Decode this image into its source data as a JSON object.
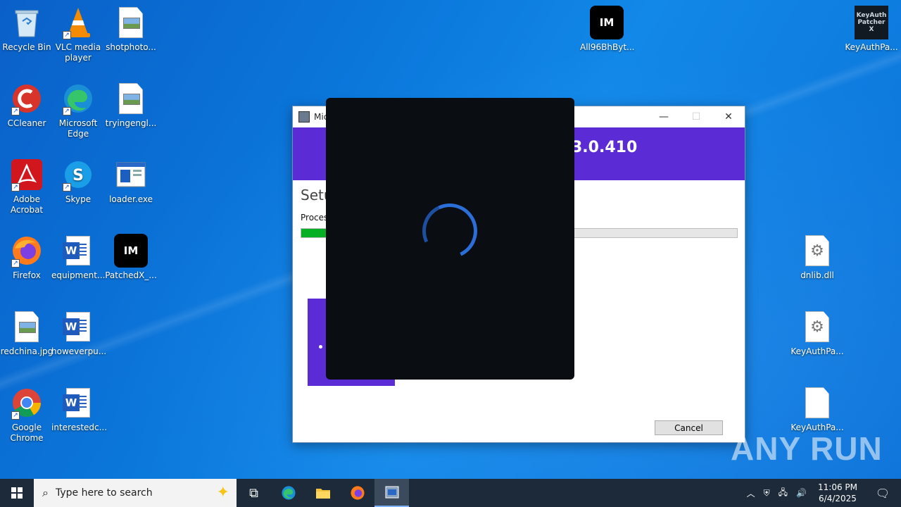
{
  "desktop": {
    "icons": [
      {
        "label": "Recycle Bin"
      },
      {
        "label": "VLC media player"
      },
      {
        "label": "shotphoto..."
      },
      {
        "label": "CCleaner"
      },
      {
        "label": "Microsoft Edge"
      },
      {
        "label": "tryingengl..."
      },
      {
        "label": "Adobe Acrobat"
      },
      {
        "label": "Skype"
      },
      {
        "label": "loader.exe"
      },
      {
        "label": "Firefox"
      },
      {
        "label": "equipment..."
      },
      {
        "label": "PatchedX_..."
      },
      {
        "label": "redchina.jpg"
      },
      {
        "label": "howeverpu..."
      },
      {
        "label": "Google Chrome"
      },
      {
        "label": "interestedc..."
      },
      {
        "label": "All96BhByt..."
      },
      {
        "label": "KeyAuthPa..."
      },
      {
        "label": "dnlib.dll"
      },
      {
        "label": "KeyAuthPa..."
      },
      {
        "label": "KeyAuthPa..."
      }
    ],
    "keyauth_tile_text": "KeyAuth Patcher X"
  },
  "installer": {
    "title": "Mic",
    "banner_version": "3.0.410",
    "setup_heading": "Setu",
    "process_label": "Process",
    "progress_percent": 6,
    "cancel_label": "Cancel"
  },
  "taskbar": {
    "search_placeholder": "Type here to search",
    "time": "11:06 PM",
    "date": "6/4/2025"
  },
  "watermark": "ANY RUN",
  "colors": {
    "banner_purple": "#5b2bd6",
    "progress_green": "#06b025",
    "overlay_black": "#0a0d12",
    "spinner_blue": "#2c6ed8"
  }
}
